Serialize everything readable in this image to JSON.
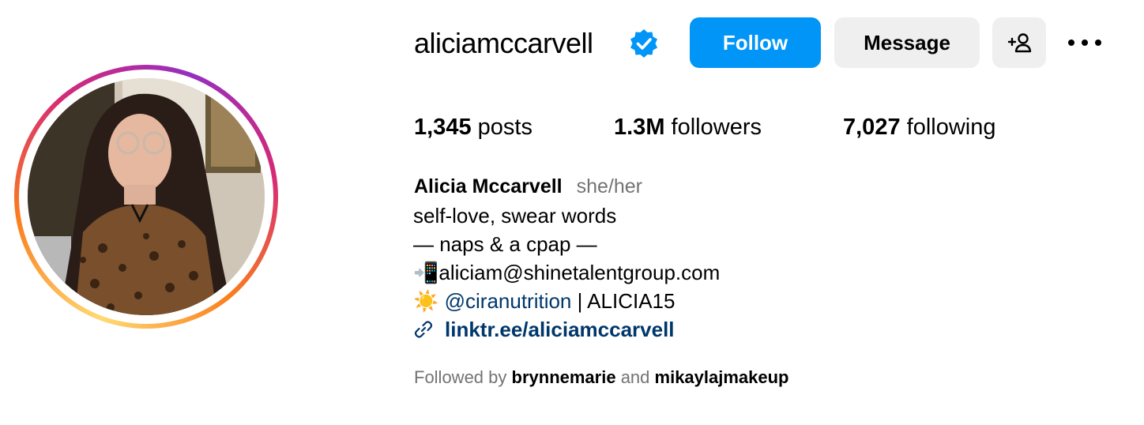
{
  "profile": {
    "username": "aliciamccarvell",
    "verified": true,
    "verified_icon": "verified-badge-icon",
    "avatar_alt": "profile picture",
    "ring_colors": [
      "#feda75",
      "#fa7e1e",
      "#d62976",
      "#962fbf"
    ]
  },
  "actions": {
    "follow_label": "Follow",
    "message_label": "Message",
    "add_user_icon": "person-add-icon",
    "more_icon": "more-options-icon",
    "follow_color": "#0095f6",
    "secondary_color": "#efefef"
  },
  "stats": {
    "posts_count": "1,345",
    "posts_label": "posts",
    "followers_count": "1.3M",
    "followers_label": "followers",
    "following_count": "7,027",
    "following_label": "following"
  },
  "bio": {
    "full_name": "Alicia Mccarvell",
    "pronouns": "she/her",
    "line1": "self-love, swear words",
    "line2": "— naps & a cpap —",
    "line3": "📲aliciam@shinetalentgroup.com",
    "line4_emoji": "☀️",
    "line4_mention": "@ciranutrition",
    "line4_rest": " | ALICIA15",
    "link_icon": "link-icon",
    "link_text": "linktr.ee/aliciamccarvell",
    "link_color": "#00376b"
  },
  "followed_by": {
    "prefix": "Followed by ",
    "account1": "brynnemarie",
    "joiner": " and ",
    "account2": "mikaylajmakeup"
  }
}
